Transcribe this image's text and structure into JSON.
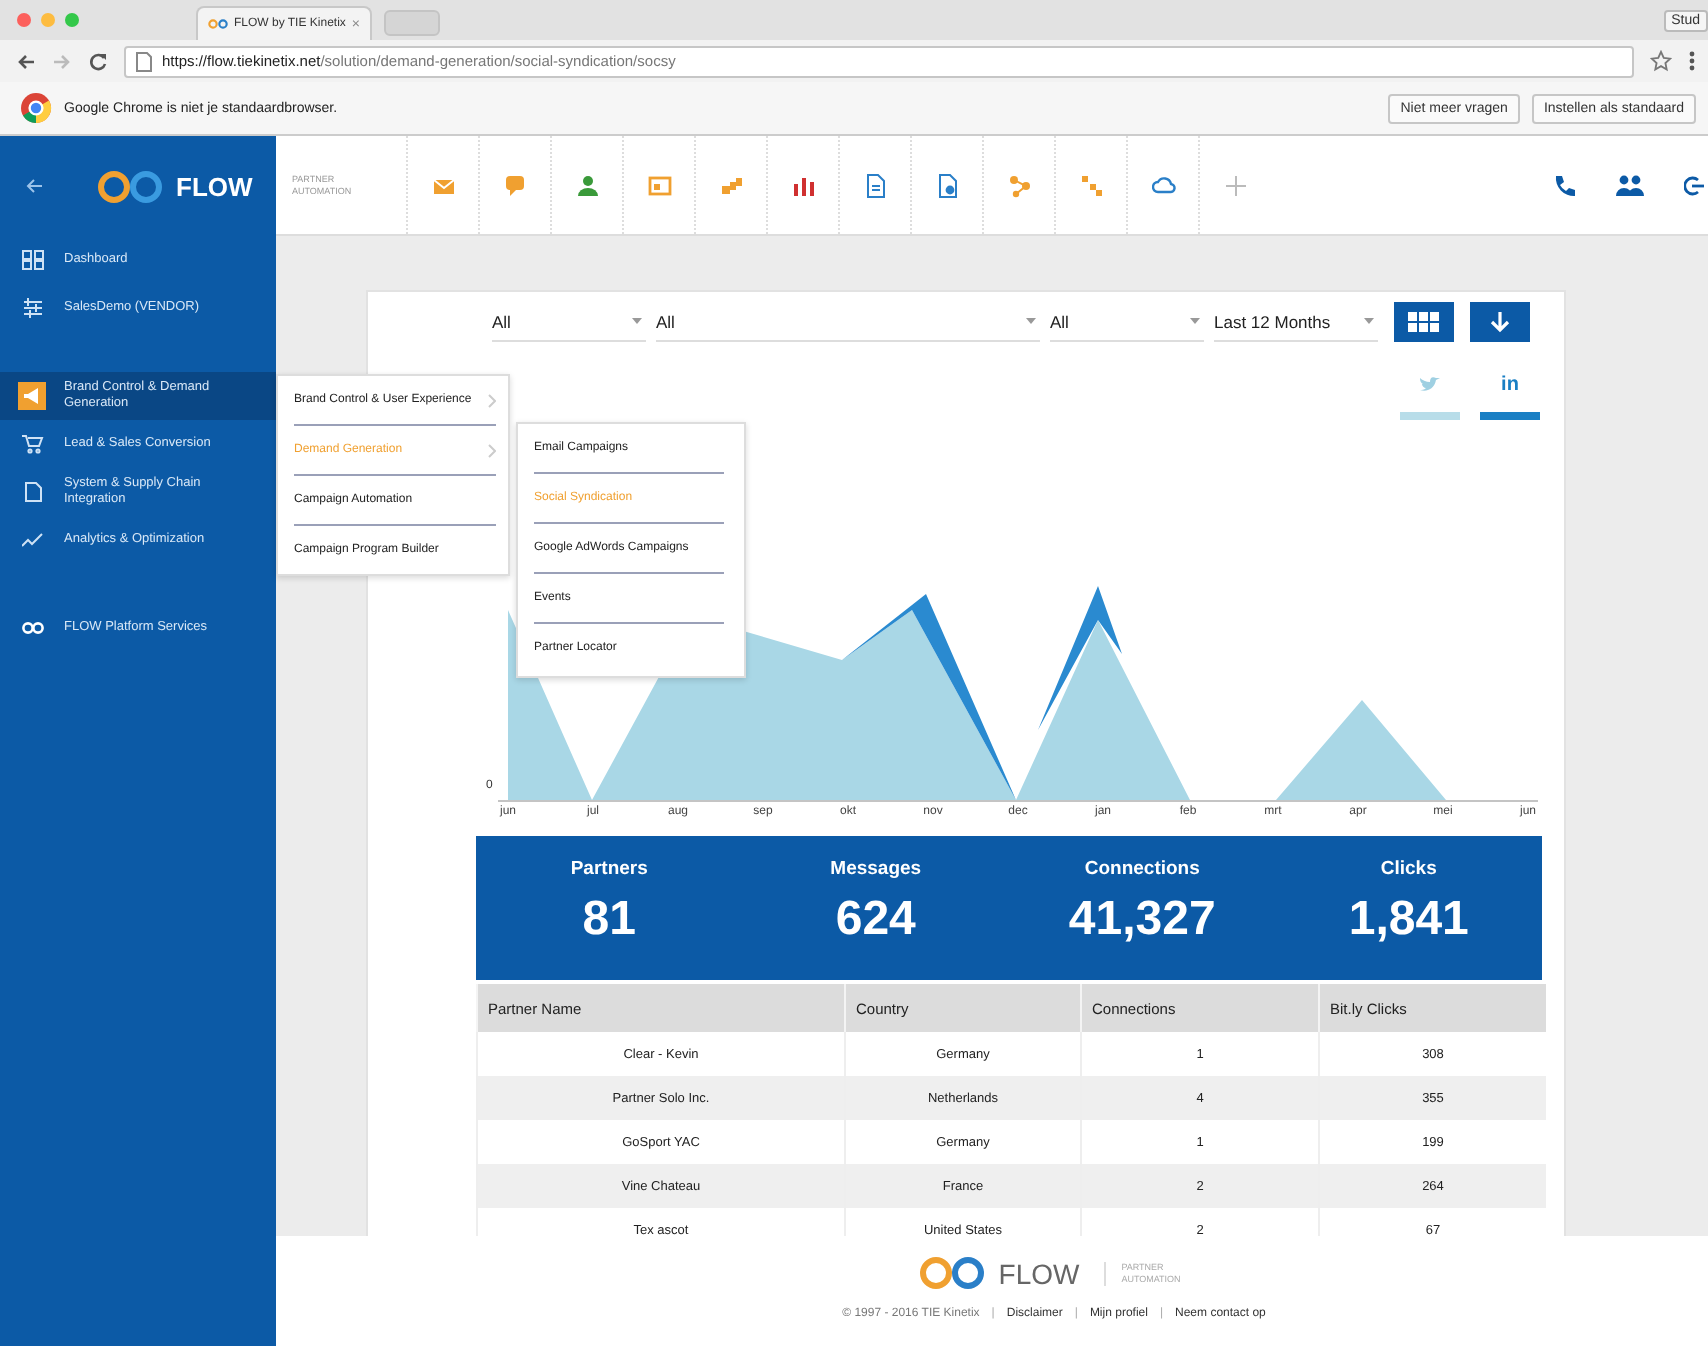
{
  "browser": {
    "tab_title": "FLOW by TIE Kinetix",
    "tab_close": "×",
    "profile": "Stud",
    "url_host": "https://flow.tiekinetix.net",
    "url_path": "/solution/demand-generation/social-syndication/socsy",
    "infobar": {
      "message": "Google Chrome is niet je standaardbrowser.",
      "buttons": [
        "Niet meer vragen",
        "Instellen als standaard"
      ]
    }
  },
  "header": {
    "logo": "FLOW",
    "tagline": "PARTNER AUTOMATION"
  },
  "sidebar": {
    "sections": [
      {
        "items": [
          {
            "label": "Dashboard",
            "selected": false
          },
          {
            "label": "SalesDemo (VENDOR)",
            "selected": false
          }
        ]
      },
      {
        "items": [
          {
            "label": "Brand Control & Demand Generation",
            "selected": true
          },
          {
            "label": "Lead & Sales Conversion",
            "selected": false
          },
          {
            "label": "System & Supply Chain Integration",
            "selected": false
          },
          {
            "label": "Analytics & Optimization",
            "selected": false
          }
        ]
      },
      {
        "items": [
          {
            "label": "FLOW Platform Services",
            "selected": false
          }
        ]
      }
    ]
  },
  "menu": {
    "items": [
      {
        "label": "Brand Control & User Experience",
        "selected": false,
        "has_submenu": true
      },
      {
        "label": "Demand Generation",
        "selected": true,
        "has_submenu": true
      },
      {
        "label": "Campaign Automation",
        "selected": false,
        "has_submenu": false
      },
      {
        "label": "Campaign Program Builder",
        "selected": false,
        "has_submenu": false
      }
    ]
  },
  "submenu": {
    "items": [
      {
        "label": "Email Campaigns",
        "selected": false
      },
      {
        "label": "Social Syndication",
        "selected": true
      },
      {
        "label": "Google AdWords Campaigns",
        "selected": false
      },
      {
        "label": "Events",
        "selected": false
      },
      {
        "label": "Partner Locator",
        "selected": false
      }
    ]
  },
  "filters": [
    {
      "value": "All"
    },
    {
      "value": "All"
    },
    {
      "value": "All"
    },
    {
      "value": "Last 12 Months"
    }
  ],
  "social_tabs": [
    {
      "kind": "twitter",
      "selected": false
    },
    {
      "kind": "linkedin",
      "label": "in",
      "selected": true
    }
  ],
  "chart": {
    "y_label": "0",
    "months": [
      "jun",
      "jul",
      "aug",
      "sep",
      "okt",
      "nov",
      "dec",
      "jan",
      "feb",
      "mrt",
      "apr",
      "mei",
      "jun"
    ]
  },
  "stats": [
    {
      "label": "Partners",
      "value": "81"
    },
    {
      "label": "Messages",
      "value": "624"
    },
    {
      "label": "Connections",
      "value": "41,327"
    },
    {
      "label": "Clicks",
      "value": "1,841"
    }
  ],
  "table": {
    "columns": [
      "Partner Name",
      "Country",
      "Connections",
      "Bit.ly Clicks"
    ],
    "rows": [
      [
        "Clear - Kevin",
        "Germany",
        "1",
        "308"
      ],
      [
        "Partner Solo Inc.",
        "Netherlands",
        "4",
        "355"
      ],
      [
        "GoSport YAC",
        "Germany",
        "1",
        "199"
      ],
      [
        "Vine Chateau",
        "France",
        "2",
        "264"
      ],
      [
        "Tex ascot",
        "United States",
        "2",
        "67"
      ]
    ]
  },
  "footer": {
    "logo": "FLOW",
    "tagline": "PARTNER AUTOMATION",
    "items": [
      {
        "kind": "text",
        "label": "© 1997 - 2016 TIE Kinetix"
      },
      {
        "kind": "separator",
        "label": "|"
      },
      {
        "kind": "link",
        "label": "Disclaimer"
      },
      {
        "kind": "separator",
        "label": "|"
      },
      {
        "kind": "link",
        "label": "Mijn profiel"
      },
      {
        "kind": "separator",
        "label": "|"
      },
      {
        "kind": "link",
        "label": "Neem contact op"
      }
    ]
  }
}
